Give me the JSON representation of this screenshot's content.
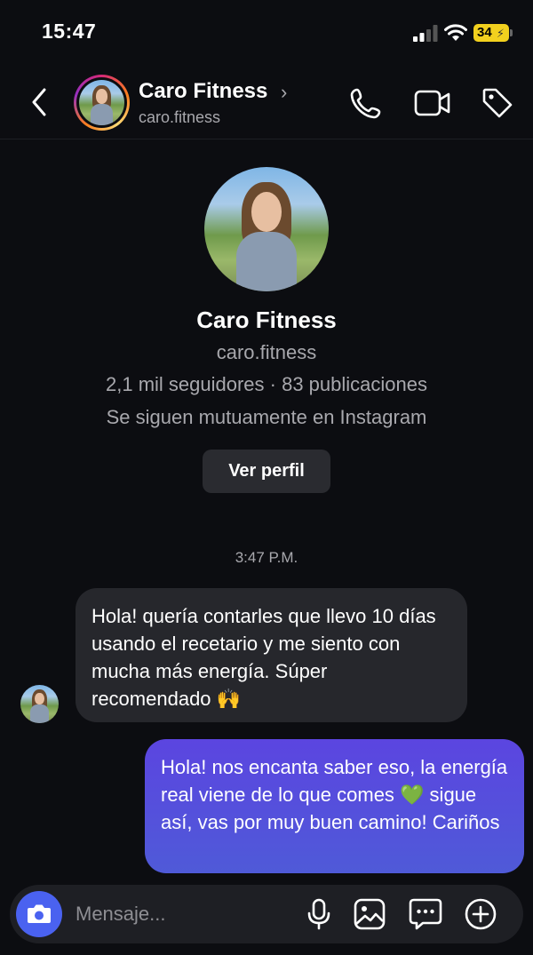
{
  "status_bar": {
    "time": "15:47",
    "battery": "34"
  },
  "header": {
    "name": "Caro Fitness",
    "chevron": "›",
    "username": "caro.fitness"
  },
  "profile": {
    "name": "Caro Fitness",
    "username": "caro.fitness",
    "stats": "2,1 mil seguidores · 83 publicaciones",
    "mutual": "Se siguen mutuamente en Instagram",
    "view_profile_label": "Ver perfil"
  },
  "conversation": {
    "timestamp": "3:47 P.M.",
    "messages": [
      {
        "direction": "incoming",
        "text": "Hola! quería contarles que llevo 10 días usando el recetario y me siento con mucha más energía. Súper recomendado 🙌"
      },
      {
        "direction": "outgoing",
        "text": "Hola! nos encanta saber eso, la energía real viene de lo que comes 💚 sigue así, vas por muy buen camino! Cariños"
      }
    ]
  },
  "composer": {
    "placeholder": "Mensaje..."
  },
  "colors": {
    "background": "#0c0d11",
    "incoming_bubble": "#26272c",
    "outgoing_bubble": "#5b45e0",
    "camera_button": "#4a62f0",
    "battery": "#f2d01e"
  },
  "icons": [
    "back-icon",
    "call-icon",
    "video-icon",
    "tag-icon",
    "camera-icon",
    "mic-icon",
    "gallery-icon",
    "sticker-icon",
    "plus-icon",
    "signal-icon",
    "wifi-icon"
  ]
}
